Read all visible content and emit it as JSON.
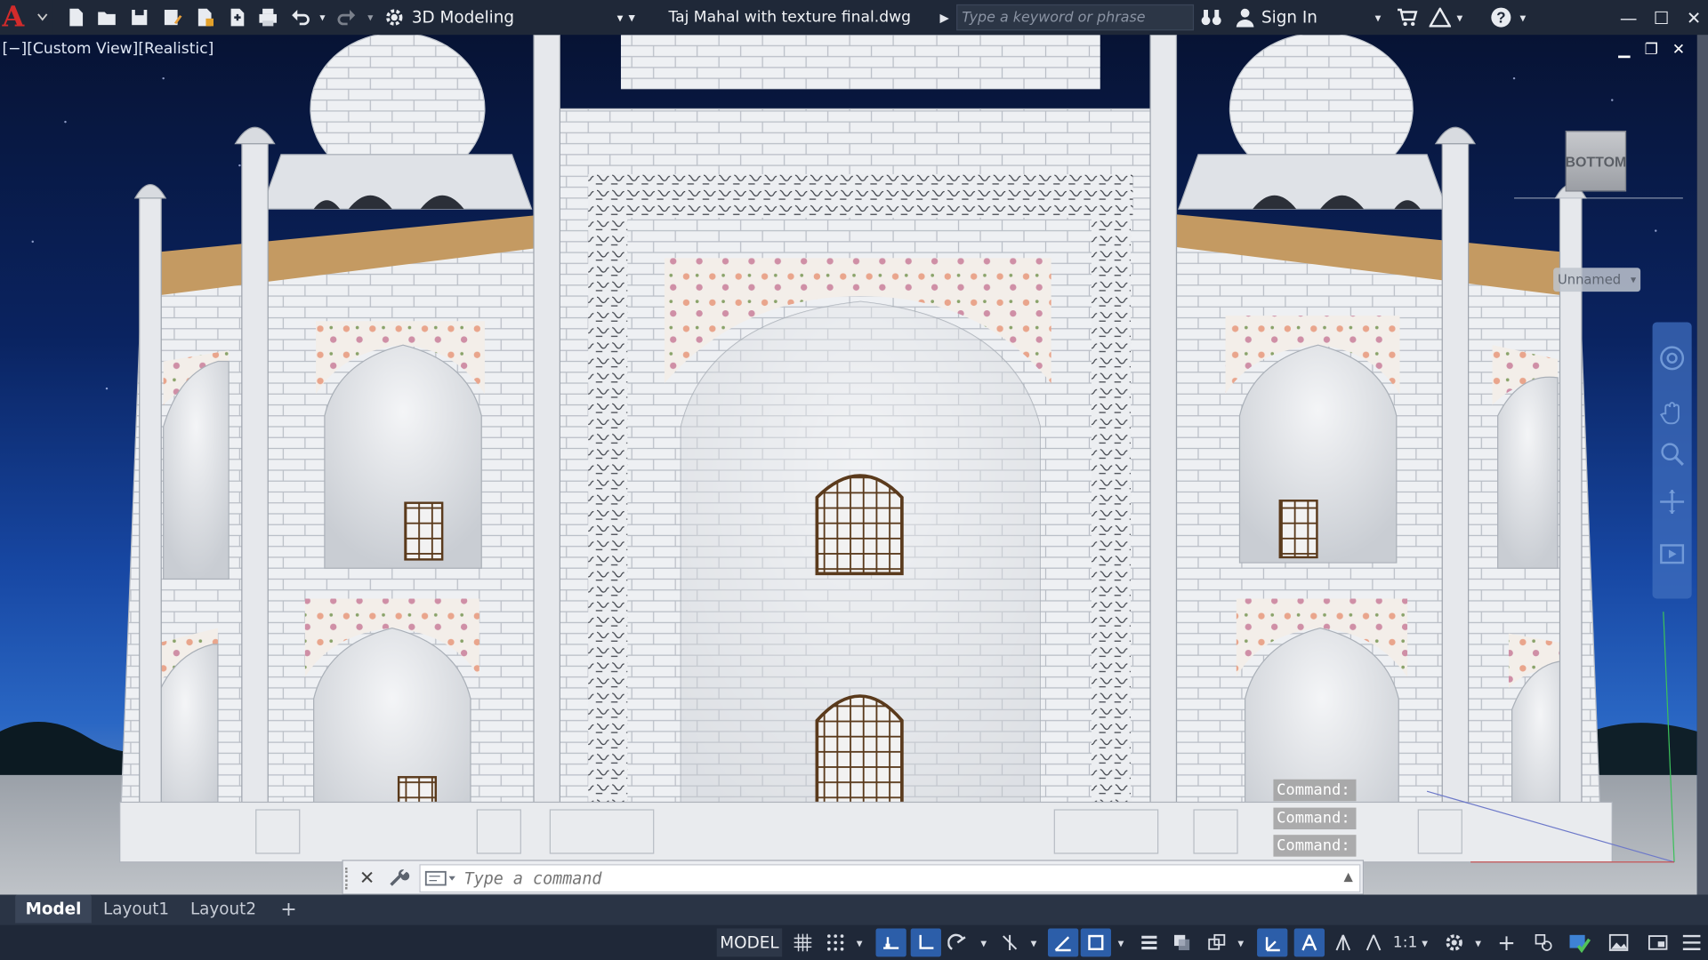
{
  "titlebar": {
    "workspace": "3D Modeling",
    "document_title": "Taj Mahal with texture final.dwg",
    "search_placeholder": "Type a keyword or phrase",
    "sign_in": "Sign In"
  },
  "viewport": {
    "label": "[−][Custom View][Realistic]",
    "viewcube_face": "BOTTOM",
    "ucs_name": "Unnamed",
    "command_history": [
      "Command:",
      "Command:",
      "Command:"
    ]
  },
  "commandline": {
    "placeholder": "Type a command"
  },
  "layout_tabs": [
    "Model",
    "Layout1",
    "Layout2"
  ],
  "statusbar": {
    "model_label": "MODEL",
    "scale": "1:1"
  },
  "colors": {
    "autocad_red": "#d22b2b",
    "chrome_dark": "#1f2838",
    "toggle_on": "#2c5ea9"
  }
}
